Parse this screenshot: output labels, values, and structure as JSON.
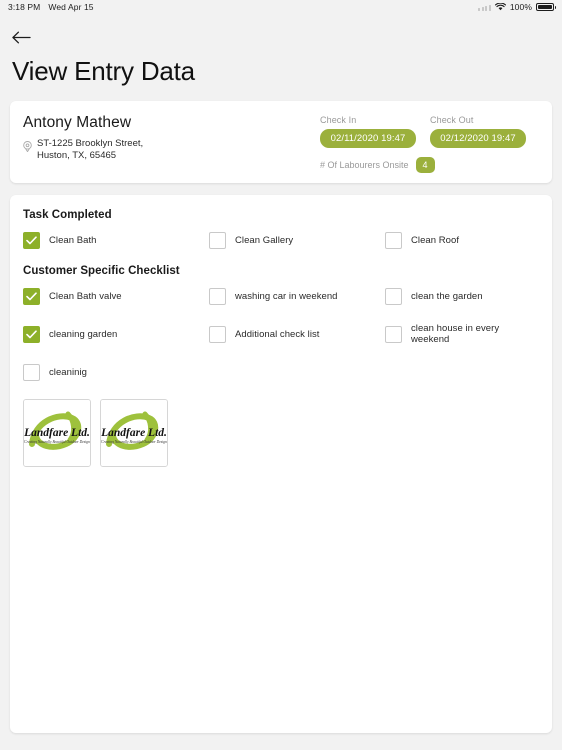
{
  "status_bar": {
    "time": "3:18 PM",
    "date": "Wed Apr 15",
    "battery_percent": "100%",
    "wifi_icon": "wifi-icon",
    "battery_icon": "battery-icon",
    "signal_icon": "signal-dots-icon"
  },
  "nav": {
    "back_icon": "arrow-left-icon",
    "title": "View Entry Data"
  },
  "entry": {
    "customer_name": "Antony Mathew",
    "address_icon": "location-pin-icon",
    "address_line1": "ST-1225 Brooklyn Street,",
    "address_line2": "Huston, TX, 65465",
    "check_in_label": "Check In",
    "check_in_value": "02/11/2020 19:47",
    "check_out_label": "Check Out",
    "check_out_value": "02/12/2020 19:47",
    "labourers_label": "# Of Labourers Onsite",
    "labourers_count": "4",
    "accent_color": "#9bb03c"
  },
  "task_completed": {
    "title": "Task Completed",
    "items": [
      {
        "label": "Clean Bath",
        "checked": true
      },
      {
        "label": "Clean Gallery",
        "checked": false
      },
      {
        "label": "Clean Roof",
        "checked": false
      }
    ]
  },
  "customer_checklist": {
    "title": "Customer Specific Checklist",
    "items": [
      {
        "label": "Clean Bath valve",
        "checked": true
      },
      {
        "label": "washing car in weekend",
        "checked": false
      },
      {
        "label": "clean the garden",
        "checked": false
      },
      {
        "label": "cleaning garden",
        "checked": true
      },
      {
        "label": "Additional check list",
        "checked": false
      },
      {
        "label": "clean house in every weekend",
        "checked": false
      },
      {
        "label": "cleaninig",
        "checked": false
      }
    ]
  },
  "photos": [
    {
      "name": "Landfare Ltd.",
      "tagline": "\"Creating Naturally Beautiful Outdoor Design\""
    },
    {
      "name": "Landfare Ltd.",
      "tagline": "\"Creating Naturally Beautiful Outdoor Design\""
    }
  ]
}
